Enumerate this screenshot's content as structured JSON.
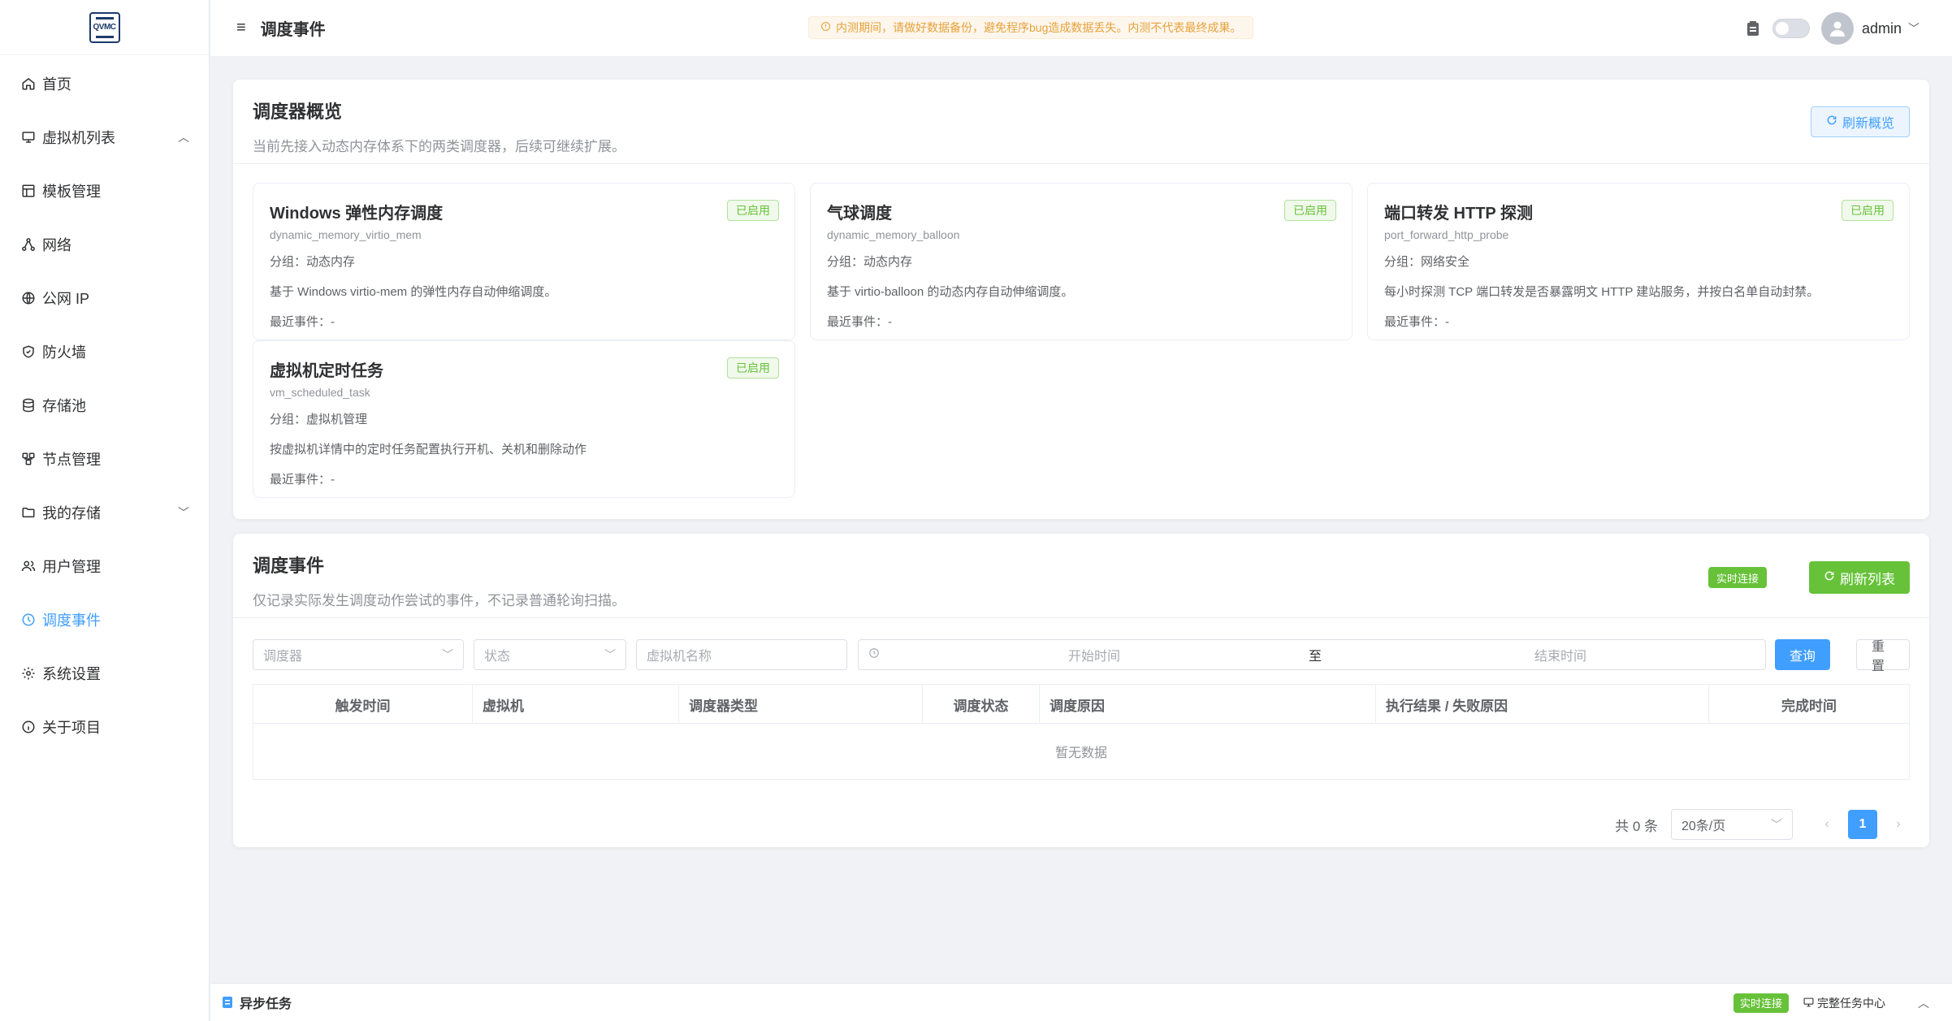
{
  "brand": {
    "logo_text": "QVMC"
  },
  "sidebar": {
    "items": [
      {
        "label": "首页",
        "icon": "home-icon"
      },
      {
        "label": "虚拟机列表",
        "icon": "monitor-icon",
        "arrow": "︿"
      },
      {
        "label": "模板管理",
        "icon": "template-icon"
      },
      {
        "label": "网络",
        "icon": "network-icon"
      },
      {
        "label": "公网 IP",
        "icon": "globe-icon"
      },
      {
        "label": "防火墙",
        "icon": "shield-icon"
      },
      {
        "label": "存储池",
        "icon": "database-icon"
      },
      {
        "label": "节点管理",
        "icon": "nodes-icon"
      },
      {
        "label": "我的存储",
        "icon": "folder-icon",
        "arrow": "﹀"
      },
      {
        "label": "用户管理",
        "icon": "users-icon"
      },
      {
        "label": "调度事件",
        "icon": "clock-icon",
        "active": true
      },
      {
        "label": "系统设置",
        "icon": "gear-icon"
      },
      {
        "label": "关于项目",
        "icon": "info-icon"
      }
    ]
  },
  "header": {
    "menu_icon": "≡",
    "title": "调度事件",
    "notice": "内测期间，请做好数据备份，避免程序bug造成数据丢失。内测不代表最终成果。",
    "user": "admin"
  },
  "overview": {
    "title": "调度器概览",
    "subtitle": "当前先接入动态内存体系下的两类调度器，后续可继续扩展。",
    "refresh_label": "刷新概览",
    "schedulers": [
      {
        "title": "Windows 弹性内存调度",
        "code": "dynamic_memory_virtio_mem",
        "status": "已启用",
        "group": "分组：动态内存",
        "desc": "基于 Windows virtio-mem 的弹性内存自动伸缩调度。",
        "last": "最近事件：-"
      },
      {
        "title": "气球调度",
        "code": "dynamic_memory_balloon",
        "status": "已启用",
        "group": "分组：动态内存",
        "desc": "基于 virtio-balloon 的动态内存自动伸缩调度。",
        "last": "最近事件：-"
      },
      {
        "title": "端口转发 HTTP 探测",
        "code": "port_forward_http_probe",
        "status": "已启用",
        "group": "分组：网络安全",
        "desc": "每小时探测 TCP 端口转发是否暴露明文 HTTP 建站服务，并按白名单自动封禁。",
        "last": "最近事件：-"
      },
      {
        "title": "虚拟机定时任务",
        "code": "vm_scheduled_task",
        "status": "已启用",
        "group": "分组：虚拟机管理",
        "desc": "按虚拟机详情中的定时任务配置执行开机、关机和删除动作",
        "last": "最近事件：-"
      }
    ]
  },
  "events": {
    "title": "调度事件",
    "subtitle": "仅记录实际发生调度动作尝试的事件，不记录普通轮询扫描。",
    "live_tag": "实时连接",
    "refresh_label": "刷新列表",
    "filters": {
      "scheduler_placeholder": "调度器",
      "status_placeholder": "状态",
      "vm_placeholder": "虚拟机名称",
      "start_placeholder": "开始时间",
      "range_sep": "至",
      "end_placeholder": "结束时间",
      "query_label": "查询",
      "reset_label": "重置"
    },
    "columns": [
      "触发时间",
      "虚拟机",
      "调度器类型",
      "调度状态",
      "调度原因",
      "执行结果 / 失败原因",
      "完成时间"
    ],
    "empty_text": "暂无数据",
    "pagination": {
      "total": "共 0 条",
      "page_size": "20条/页",
      "current_page": "1",
      "prev": "‹",
      "next": "›"
    }
  },
  "bottom_bar": {
    "title": "异步任务",
    "live_tag": "实时连接",
    "link": "完整任务中心",
    "caret": "︿"
  },
  "colors": {
    "primary": "#409eff",
    "success": "#67c23a",
    "warning": "#e6a23c"
  }
}
